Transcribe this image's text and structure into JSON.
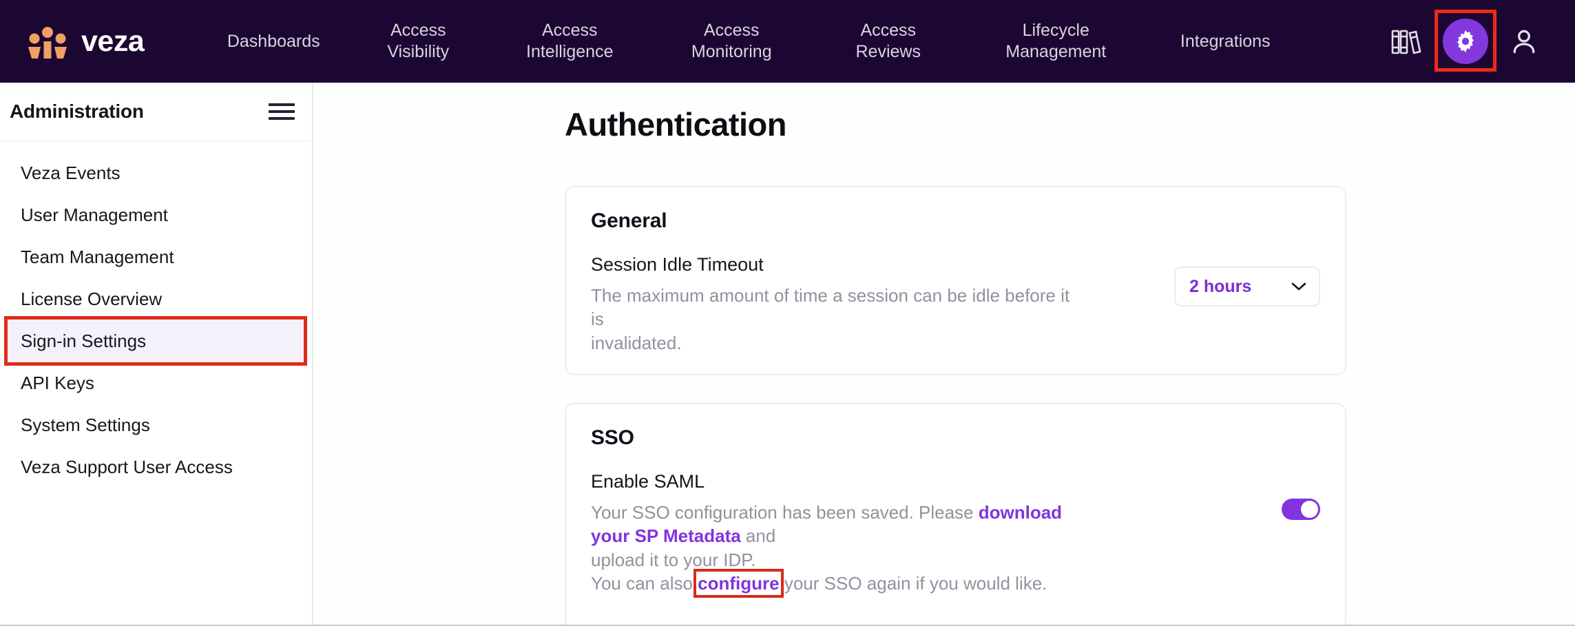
{
  "brand": {
    "name": "veza",
    "logo_icon": "veza-people-logo-icon",
    "logo_color": "#f0a062"
  },
  "topnav": {
    "background": "#1c0733",
    "items": [
      {
        "label": "Dashboards"
      },
      {
        "label": "Access\nVisibility"
      },
      {
        "label": "Access\nIntelligence"
      },
      {
        "label": "Access\nMonitoring"
      },
      {
        "label": "Access\nReviews"
      },
      {
        "label": "Lifecycle\nManagement"
      },
      {
        "label": "Integrations"
      }
    ],
    "actions": {
      "library_icon": "books-icon",
      "settings_icon": "gear-icon",
      "settings_active": true,
      "settings_accent": "#8338dd",
      "profile_icon": "person-icon",
      "highlight_color": "#ee2b16"
    }
  },
  "sidebar": {
    "title": "Administration",
    "menu_icon": "hamburger-icon",
    "active_item": "Sign-in Settings",
    "highlight_color": "#e02b17",
    "active_background": "#f4f1fb",
    "items": [
      {
        "label": "Veza Events",
        "active": false
      },
      {
        "label": "User Management",
        "active": false
      },
      {
        "label": "Team Management",
        "active": false
      },
      {
        "label": "License Overview",
        "active": false
      },
      {
        "label": "Sign-in Settings",
        "active": true
      },
      {
        "label": "API Keys",
        "active": false
      },
      {
        "label": "System Settings",
        "active": false
      },
      {
        "label": "Veza Support User Access",
        "active": false
      }
    ]
  },
  "main": {
    "page_title": "Authentication",
    "cards": {
      "general": {
        "heading": "General",
        "setting_label": "Session Idle Timeout",
        "desc_line_1": "The maximum amount of time a session can be idle before it is",
        "desc_line_2": "invalidated.",
        "select": {
          "value": "2 hours",
          "chevron_icon": "chevron-down-icon",
          "value_color": "#7a2fd4"
        }
      },
      "sso": {
        "heading": "SSO",
        "setting_label": "Enable SAML",
        "desc_line_1_a": "Your SSO configuration has been saved. Please ",
        "desc_line_1_link": "download your SP Metadata",
        "desc_line_1_b": " and",
        "desc_line_2": "upload it to your IDP.",
        "desc_line_3_a": "You can also ",
        "desc_line_3_link": "configure",
        "desc_line_3_b": " your SSO again if you would like.",
        "toggle": {
          "name": "enable-saml-toggle",
          "state": "on",
          "color": "#8133e0"
        },
        "link_color": "#8133e0",
        "link_highlight_color": "#d7291b"
      }
    }
  }
}
